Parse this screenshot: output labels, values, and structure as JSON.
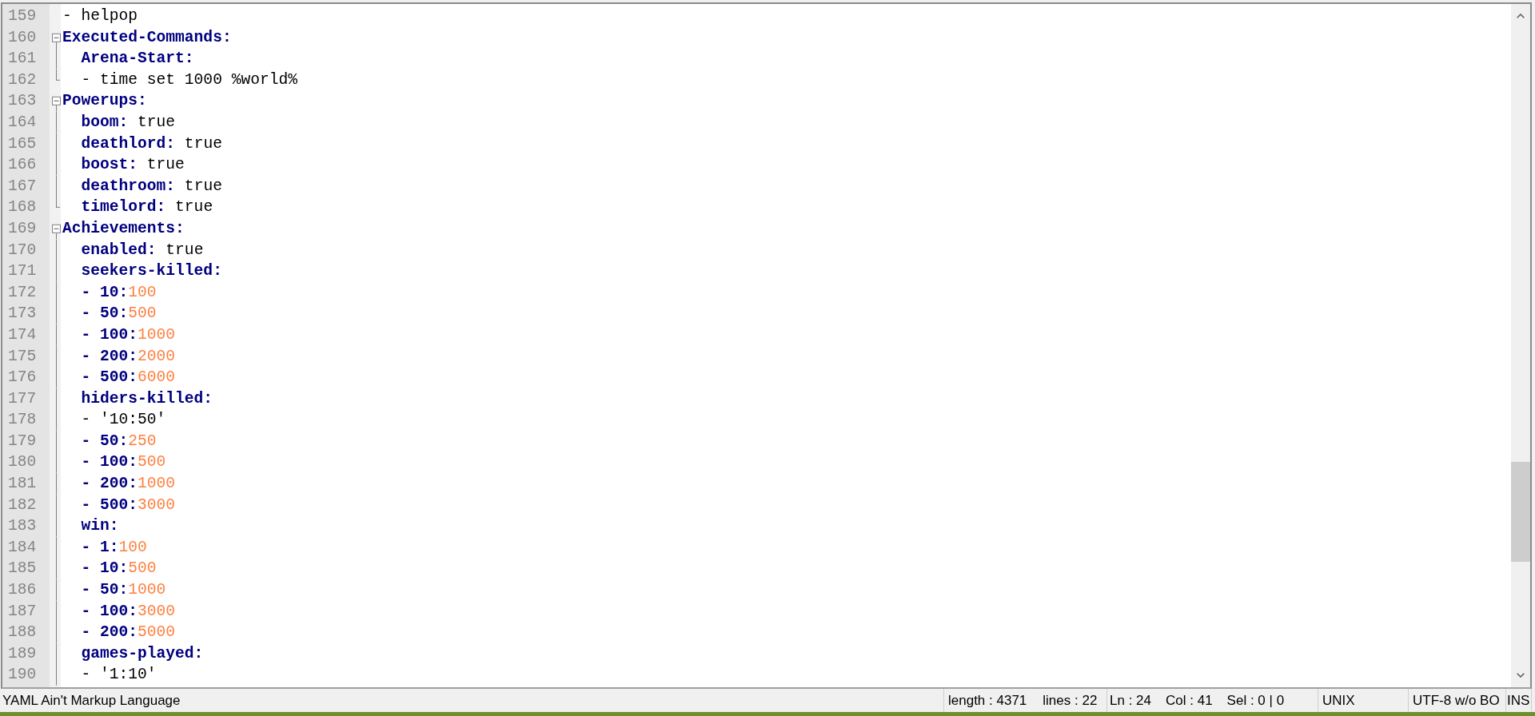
{
  "editor": {
    "lines": [
      {
        "number": "159",
        "segments": [
          {
            "kind": "plain",
            "text": "- helpop"
          }
        ]
      },
      {
        "number": "160",
        "segments": [
          {
            "kind": "key",
            "text": "Executed-Commands:"
          }
        ],
        "expanded": true,
        "end_shown": true,
        "children": [
          {
            "number": "161",
            "segments": [
              {
                "kind": "key",
                "text": "Arena-Start:"
              }
            ]
          },
          {
            "number": "162",
            "segments": [
              {
                "kind": "plain",
                "text": "- time set 1000 %world%"
              }
            ]
          }
        ]
      },
      {
        "number": "163",
        "segments": [
          {
            "kind": "key",
            "text": "Powerups:"
          }
        ],
        "expanded": true,
        "end_shown": true,
        "children": [
          {
            "number": "164",
            "segments": [
              {
                "kind": "key",
                "text": "boom:"
              },
              {
                "kind": "plain",
                "text": " true"
              }
            ]
          },
          {
            "number": "165",
            "segments": [
              {
                "kind": "key",
                "text": "deathlord:"
              },
              {
                "kind": "plain",
                "text": " true"
              }
            ]
          },
          {
            "number": "166",
            "segments": [
              {
                "kind": "key",
                "text": "boost:"
              },
              {
                "kind": "plain",
                "text": " true"
              }
            ]
          },
          {
            "number": "167",
            "segments": [
              {
                "kind": "key",
                "text": "deathroom:"
              },
              {
                "kind": "plain",
                "text": " true"
              }
            ]
          },
          {
            "number": "168",
            "segments": [
              {
                "kind": "key",
                "text": "timelord:"
              },
              {
                "kind": "plain",
                "text": " true"
              }
            ]
          }
        ]
      },
      {
        "number": "169",
        "segments": [
          {
            "kind": "key",
            "text": "Achievements:"
          }
        ],
        "expanded": true,
        "end_shown": false,
        "children": [
          {
            "number": "170",
            "segments": [
              {
                "kind": "key",
                "text": "enabled:"
              },
              {
                "kind": "plain",
                "text": " true"
              }
            ]
          },
          {
            "number": "171",
            "segments": [
              {
                "kind": "key",
                "text": "seekers-killed:"
              }
            ]
          },
          {
            "number": "172",
            "segments": [
              {
                "kind": "key",
                "text": "- 10:"
              },
              {
                "kind": "number",
                "text": "100"
              }
            ]
          },
          {
            "number": "173",
            "segments": [
              {
                "kind": "key",
                "text": "- 50:"
              },
              {
                "kind": "number",
                "text": "500"
              }
            ]
          },
          {
            "number": "174",
            "segments": [
              {
                "kind": "key",
                "text": "- 100:"
              },
              {
                "kind": "number",
                "text": "1000"
              }
            ]
          },
          {
            "number": "175",
            "segments": [
              {
                "kind": "key",
                "text": "- 200:"
              },
              {
                "kind": "number",
                "text": "2000"
              }
            ]
          },
          {
            "number": "176",
            "segments": [
              {
                "kind": "key",
                "text": "- 500:"
              },
              {
                "kind": "number",
                "text": "6000"
              }
            ]
          },
          {
            "number": "177",
            "segments": [
              {
                "kind": "key",
                "text": "hiders-killed:"
              }
            ]
          },
          {
            "number": "178",
            "segments": [
              {
                "kind": "plain",
                "text": "- '10:50'"
              }
            ]
          },
          {
            "number": "179",
            "segments": [
              {
                "kind": "key",
                "text": "- 50:"
              },
              {
                "kind": "number",
                "text": "250"
              }
            ]
          },
          {
            "number": "180",
            "segments": [
              {
                "kind": "key",
                "text": "- 100:"
              },
              {
                "kind": "number",
                "text": "500"
              }
            ]
          },
          {
            "number": "181",
            "segments": [
              {
                "kind": "key",
                "text": "- 200:"
              },
              {
                "kind": "number",
                "text": "1000"
              }
            ]
          },
          {
            "number": "182",
            "segments": [
              {
                "kind": "key",
                "text": "- 500:"
              },
              {
                "kind": "number",
                "text": "3000"
              }
            ]
          },
          {
            "number": "183",
            "segments": [
              {
                "kind": "key",
                "text": "win:"
              }
            ]
          },
          {
            "number": "184",
            "segments": [
              {
                "kind": "key",
                "text": "- 1:"
              },
              {
                "kind": "number",
                "text": "100"
              }
            ]
          },
          {
            "number": "185",
            "segments": [
              {
                "kind": "key",
                "text": "- 10:"
              },
              {
                "kind": "number",
                "text": "500"
              }
            ]
          },
          {
            "number": "186",
            "segments": [
              {
                "kind": "key",
                "text": "- 50:"
              },
              {
                "kind": "number",
                "text": "1000"
              }
            ]
          },
          {
            "number": "187",
            "segments": [
              {
                "kind": "key",
                "text": "- 100:"
              },
              {
                "kind": "number",
                "text": "3000"
              }
            ]
          },
          {
            "number": "188",
            "segments": [
              {
                "kind": "key",
                "text": "- 200:"
              },
              {
                "kind": "number",
                "text": "5000"
              }
            ]
          },
          {
            "number": "189",
            "segments": [
              {
                "kind": "key",
                "text": "games-played:"
              }
            ]
          },
          {
            "number": "190",
            "segments": [
              {
                "kind": "plain",
                "text": "- '1:10'"
              }
            ]
          }
        ]
      }
    ]
  },
  "status_bar": {
    "panels": [
      {
        "texts": [
          "YAML Ain't Markup Language"
        ]
      },
      {
        "texts": [
          "length : 4371",
          "lines : 22"
        ]
      },
      {
        "texts": [
          "Ln : 24",
          "Col : 41",
          "Sel : 0 | 0"
        ]
      },
      {
        "texts": [
          "UNIX"
        ]
      },
      {
        "texts": [
          "UTF-8 w/o BO"
        ]
      },
      {
        "texts": [
          "INS"
        ]
      }
    ]
  }
}
